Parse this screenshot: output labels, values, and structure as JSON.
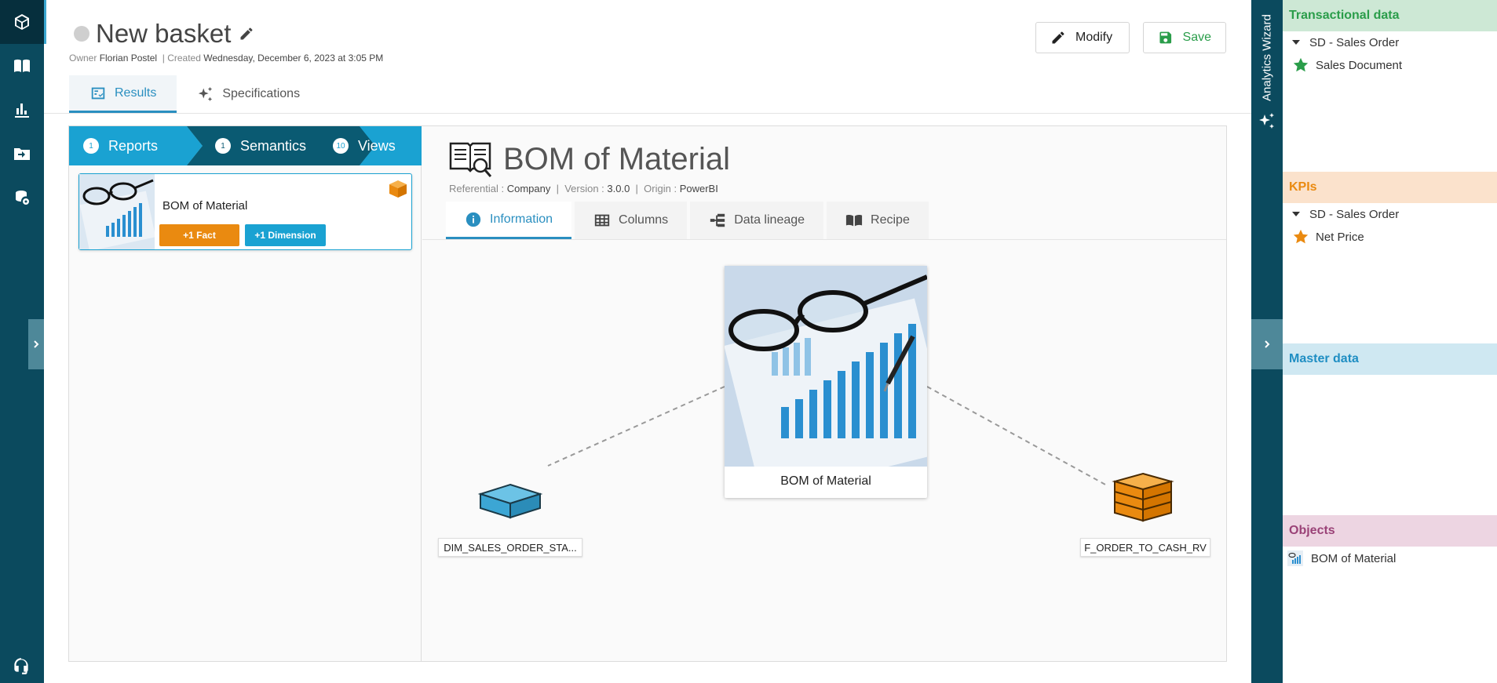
{
  "nav": {
    "items": [
      "cube-icon",
      "book-icon",
      "bar-chart-icon",
      "folder-arrow-icon",
      "db-settings-icon"
    ],
    "active": 0
  },
  "header": {
    "title": "New basket",
    "owner_label": "Owner",
    "owner": "Florian Postel",
    "separator": "|",
    "created_label": "Created",
    "created": "Wednesday, December 6, 2023 at 3:05 PM",
    "modify_label": "Modify",
    "save_label": "Save"
  },
  "tabs": {
    "results": "Results",
    "specifications": "Specifications",
    "active": "results"
  },
  "stepper": {
    "reports": {
      "count": "1",
      "label": "Reports"
    },
    "semantics": {
      "count": "1",
      "label": "Semantics"
    },
    "views": {
      "count": "10",
      "label": "Views"
    },
    "active": "semantics"
  },
  "result_card": {
    "name": "BOM of Material",
    "fact_badge": "+1 Fact",
    "dim_badge": "+1 Dimension"
  },
  "detail": {
    "title": "BOM of Material",
    "referential_label": "Referential :",
    "referential": "Company",
    "version_label": "Version :",
    "version": "3.0.0",
    "origin_label": "Origin :",
    "origin": "PowerBI",
    "tabs": {
      "information": "Information",
      "columns": "Columns",
      "data_lineage": "Data lineage",
      "recipe": "Recipe"
    },
    "active_tab": "information"
  },
  "lineage": {
    "center": "BOM of Material",
    "dimension": "DIM_SALES_ORDER_STA...",
    "fact": "F_ORDER_TO_CASH_RV"
  },
  "wizard": {
    "label": "Analytics Wizard",
    "sections": {
      "transactional": {
        "title": "Transactional data",
        "group": "SD - Sales Order",
        "item": "Sales Document"
      },
      "kpis": {
        "title": "KPIs",
        "group": "SD - Sales Order",
        "item": "Net Price"
      },
      "master": {
        "title": "Master data"
      },
      "objects": {
        "title": "Objects",
        "item": "BOM of Material"
      }
    }
  },
  "colors": {
    "nav_bg": "#0b4a5e",
    "accent_blue": "#1aa2d2",
    "semantic_dark": "#0a5a72",
    "fact_orange": "#ea8a10",
    "save_green": "#2a9d4a",
    "objects_purple": "#9a4277"
  }
}
